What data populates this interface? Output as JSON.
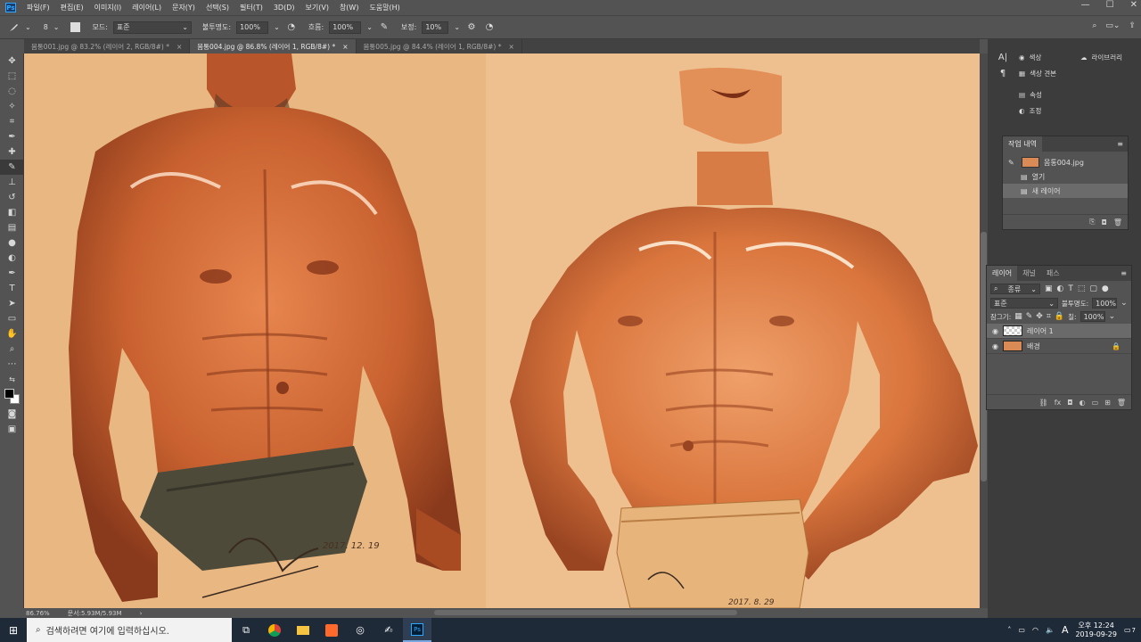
{
  "menu": [
    "파일(F)",
    "편집(E)",
    "이미지(I)",
    "레이어(L)",
    "문자(Y)",
    "선택(S)",
    "필터(T)",
    "3D(D)",
    "보기(V)",
    "창(W)",
    "도움말(H)"
  ],
  "window_controls": {
    "minimize": "—",
    "maximize": "☐",
    "close": "✕"
  },
  "options": {
    "brush_size": "8",
    "mode_label": "모드:",
    "mode_value": "표준",
    "opacity_label": "불투명도:",
    "opacity_value": "100%",
    "flow_label": "흐름:",
    "flow_value": "100%",
    "smoothing_label": "보정:",
    "smoothing_value": "10%"
  },
  "tabs": [
    {
      "label": "몸통001.jpg @ 83.2% (레이어 2, RGB/8#) *",
      "close": "×"
    },
    {
      "label": "몸통004.jpg @ 86.8% (레이어 1, RGB/8#) *",
      "close": "×"
    },
    {
      "label": "몸통005.jpg @ 84.4% (레이어 1, RGB/8#) *",
      "close": "×"
    }
  ],
  "status": {
    "zoom": "86.76%",
    "doc": "문서:5.93M/5.93M"
  },
  "collapsed_panels": {
    "color": "색상",
    "swatches": "색상 견본",
    "properties": "속성",
    "adjustments": "조정",
    "libraries": "라이브러리"
  },
  "history": {
    "title": "작업 내역",
    "snapshot": "몸통004.jpg",
    "items": [
      "열기",
      "새 레이어"
    ]
  },
  "layers": {
    "tabs": [
      "레이어",
      "채널",
      "패스"
    ],
    "filter_label": "종류",
    "blend_mode": "표준",
    "opacity_label": "불투명도:",
    "opacity_value": "100%",
    "lock_label": "잠그기:",
    "fill_label": "칠:",
    "fill_value": "100%",
    "items": [
      {
        "name": "레이어 1"
      },
      {
        "name": "배경"
      }
    ]
  },
  "artwork": {
    "left_signature": "2017. 12. 19",
    "right_signature": "2017. 8. 29"
  },
  "taskbar": {
    "search_placeholder": "검색하려면 여기에 입력하십시오.",
    "time": "오후 12:24",
    "date": "2019-09-29",
    "ime": "A",
    "notifications": "7"
  }
}
